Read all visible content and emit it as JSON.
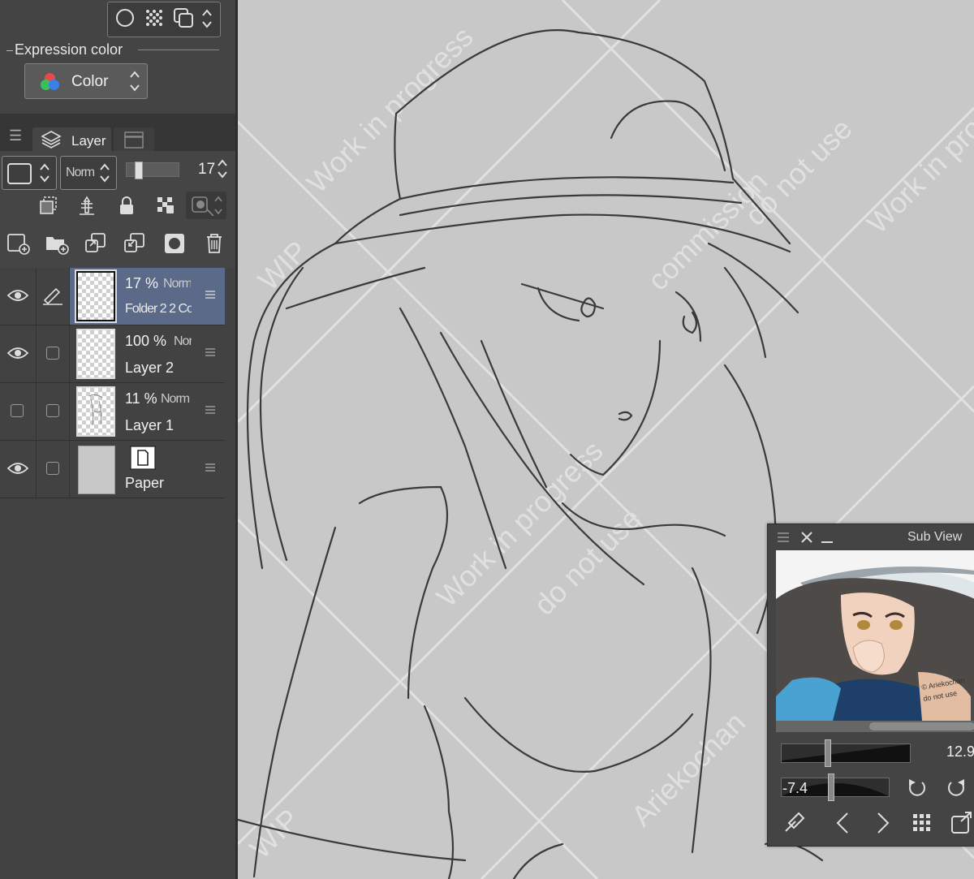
{
  "left_panel": {
    "expression_color_label": "Expression color",
    "color_button_label": "Color",
    "layer_tab_label": "Layer",
    "blend_mode": "Norm",
    "opacity_value": "17",
    "opacity_fraction": 0.17,
    "layers": [
      {
        "opacity": "17 %",
        "mode": "Norm",
        "name": "Folder 2 2 Co",
        "visible": true,
        "selected": true,
        "editing": true,
        "type": "folder"
      },
      {
        "opacity": "100 %",
        "mode": "Nor",
        "name": "Layer 2",
        "visible": true,
        "selected": false,
        "editing": false,
        "type": "raster"
      },
      {
        "opacity": "11 %",
        "mode": "Norm",
        "name": "Layer 1",
        "visible": false,
        "selected": false,
        "editing": false,
        "type": "raster"
      },
      {
        "opacity": "",
        "mode": "",
        "name": "Paper",
        "visible": true,
        "selected": false,
        "editing": false,
        "type": "paper"
      }
    ]
  },
  "sub_view": {
    "title": "Sub View",
    "zoom_value": "12.9",
    "rotation_value": "-7.4",
    "zoom_fraction": 0.35,
    "rotation_fraction": 0.45
  },
  "watermark": {
    "phrases": [
      "WIP",
      "Work in progress",
      "do not use",
      "commission",
      "Ariekochan"
    ]
  },
  "colors": {
    "panel_bg": "#424242",
    "selected_row": "#5b6a88",
    "canvas_bg": "#c8c8c8"
  }
}
